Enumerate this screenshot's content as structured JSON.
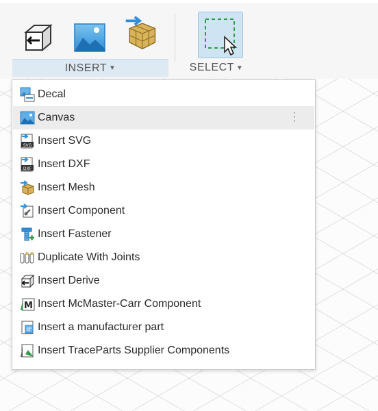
{
  "toolbar": {
    "insert_label": "INSERT",
    "select_label": "SELECT",
    "icons": [
      "derive-icon",
      "canvas-icon",
      "insert-mesh-icon",
      "select-box-icon"
    ]
  },
  "menu": {
    "items": [
      {
        "label": "Decal",
        "icon": "decal-icon"
      },
      {
        "label": "Canvas",
        "icon": "canvas-icon"
      },
      {
        "label": "Insert SVG",
        "icon": "svg-icon"
      },
      {
        "label": "Insert DXF",
        "icon": "dxf-icon"
      },
      {
        "label": "Insert Mesh",
        "icon": "mesh-icon"
      },
      {
        "label": "Insert Component",
        "icon": "component-icon"
      },
      {
        "label": "Insert Fastener",
        "icon": "fastener-icon"
      },
      {
        "label": "Duplicate With Joints",
        "icon": "duplicate-joints-icon"
      },
      {
        "label": "Insert Derive",
        "icon": "derive-icon"
      },
      {
        "label": "Insert McMaster-Carr Component",
        "icon": "mcmaster-icon"
      },
      {
        "label": "Insert a manufacturer part",
        "icon": "manufacturer-part-icon"
      },
      {
        "label": "Insert TraceParts Supplier Components",
        "icon": "traceparts-icon"
      }
    ],
    "hovered_item": "Canvas"
  },
  "colors": {
    "accent": "#2f8fd8",
    "hover_bg": "#ececec",
    "insert_label_bg": "#dde9f3",
    "select_active_bg": "#cfe4f3"
  }
}
